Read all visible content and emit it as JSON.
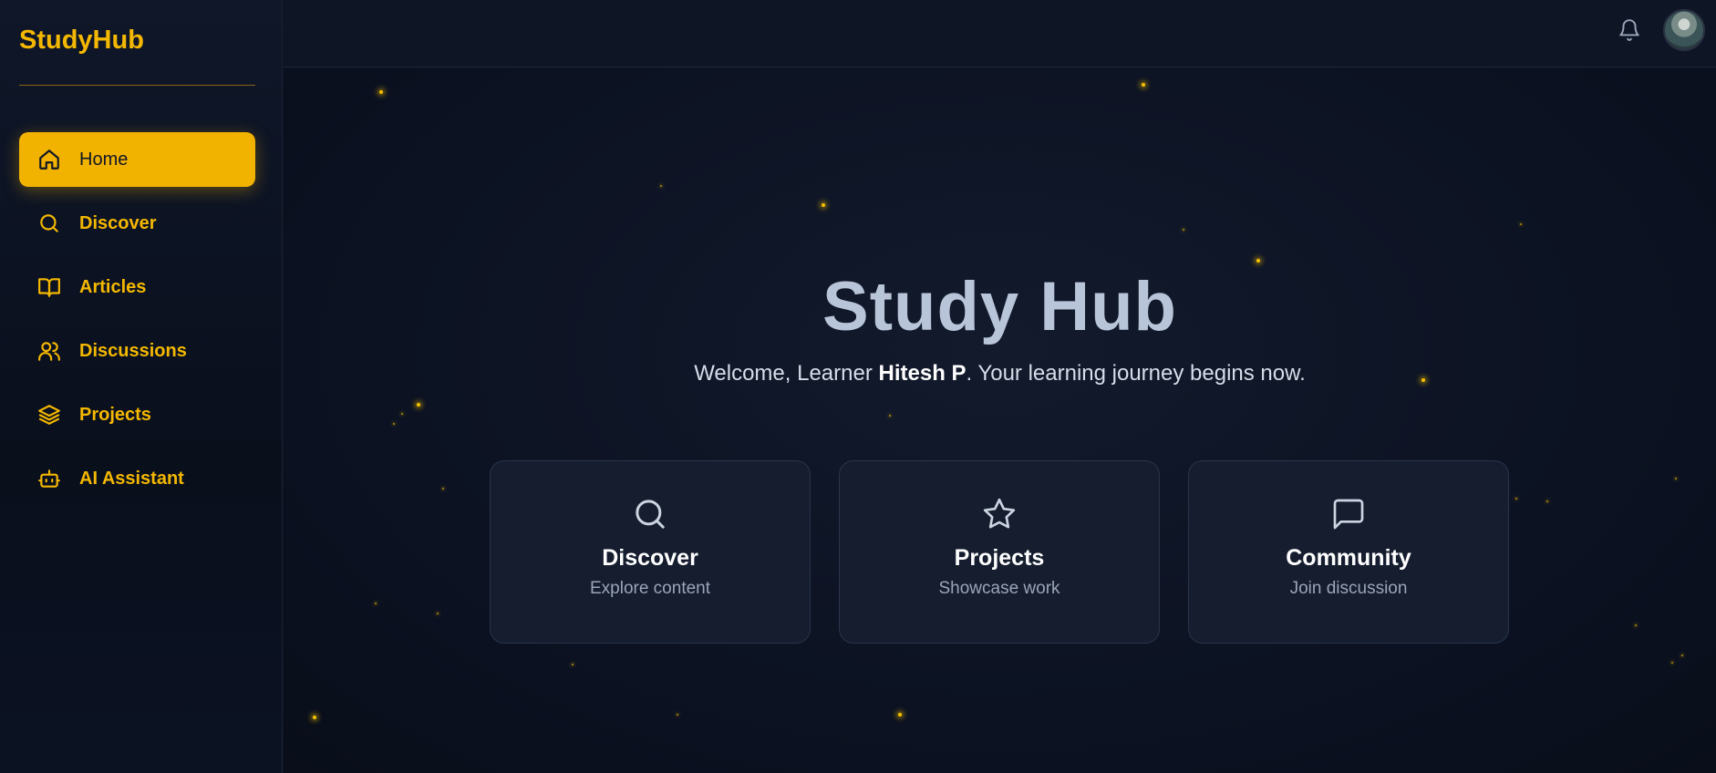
{
  "app": {
    "logo": "StudyHub"
  },
  "sidebar": {
    "items": [
      {
        "label": "Home",
        "icon": "home-icon",
        "active": true
      },
      {
        "label": "Discover",
        "icon": "search-icon"
      },
      {
        "label": "Articles",
        "icon": "book-open-icon"
      },
      {
        "label": "Discussions",
        "icon": "users-icon"
      },
      {
        "label": "Projects",
        "icon": "layers-icon"
      },
      {
        "label": "AI Assistant",
        "icon": "bot-icon"
      }
    ]
  },
  "header": {
    "notifications_icon": "bell-icon",
    "avatar": "user-avatar"
  },
  "hero": {
    "title": "Study Hub",
    "welcome_prefix": "Welcome, Learner ",
    "user_name": "Hitesh P",
    "welcome_suffix": ". Your learning journey begins now."
  },
  "cards": [
    {
      "title": "Discover",
      "desc": "Explore content",
      "icon": "search-icon"
    },
    {
      "title": "Projects",
      "desc": "Showcase work",
      "icon": "star-icon"
    },
    {
      "title": "Community",
      "desc": "Join discussion",
      "icon": "message-square-icon"
    }
  ],
  "colors": {
    "accent": "#f2b200",
    "background": "#0c1220",
    "card": "#151d2f"
  }
}
